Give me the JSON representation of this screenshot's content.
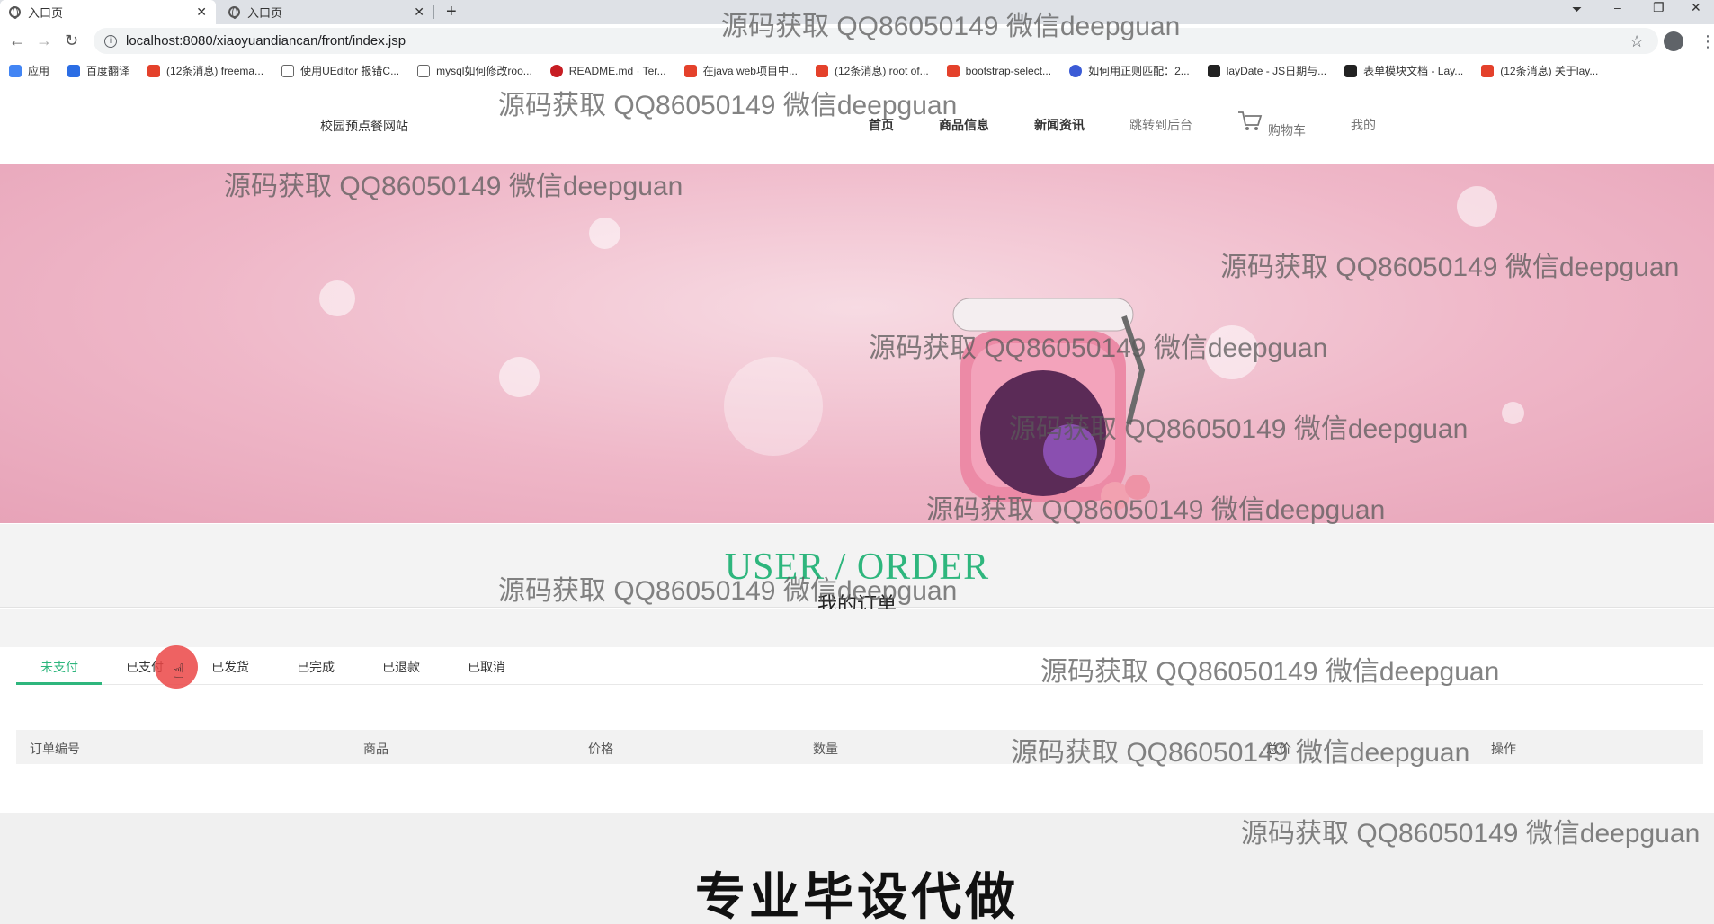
{
  "browser": {
    "tabs": [
      {
        "title": "入口页",
        "active": true
      },
      {
        "title": "入口页",
        "active": false
      }
    ],
    "url": "localhost:8080/xiaoyuandiancan/front/index.jsp",
    "bookmarks": [
      {
        "label": "应用",
        "color": "#4285f4"
      },
      {
        "label": "百度翻译",
        "color": "#2b6de4"
      },
      {
        "label": "(12条消息) freema...",
        "color": "#e4412b"
      },
      {
        "label": "使用UEditor 报错C...",
        "color": "#666666"
      },
      {
        "label": "mysql如何修改roo...",
        "color": "#666666"
      },
      {
        "label": "README.md · Ter...",
        "color": "#c71d23"
      },
      {
        "label": "在java web项目中...",
        "color": "#e4412b"
      },
      {
        "label": "(12条消息) root of...",
        "color": "#e4412b"
      },
      {
        "label": "bootstrap-select...",
        "color": "#e4412b"
      },
      {
        "label": "如何用正则匹配：2...",
        "color": "#3b5bd6"
      },
      {
        "label": "layDate - JS日期与...",
        "color": "#222222"
      },
      {
        "label": "表单模块文档 - Lay...",
        "color": "#222222"
      },
      {
        "label": "(12条消息) 关于lay...",
        "color": "#e4412b"
      }
    ]
  },
  "header": {
    "brand": "校园预点餐网站",
    "nav": [
      "首页",
      "商品信息",
      "新闻资讯",
      "跳转到后台",
      "购物车",
      "我的"
    ]
  },
  "section": {
    "title_en": "USER / ORDER",
    "title_cn": "我的订单"
  },
  "order_tabs": [
    "未支付",
    "已支付",
    "已发货",
    "已完成",
    "已退款",
    "已取消"
  ],
  "table": {
    "headers": [
      "订单编号",
      "商品",
      "价格",
      "数量",
      "总价",
      "操作"
    ]
  },
  "footer": {
    "slogan": "专业毕设代做"
  },
  "watermark": "源码获取 QQ86050149 微信deepguan",
  "colors": {
    "accent": "#2eb67d",
    "click_indicator": "#eb4646"
  }
}
